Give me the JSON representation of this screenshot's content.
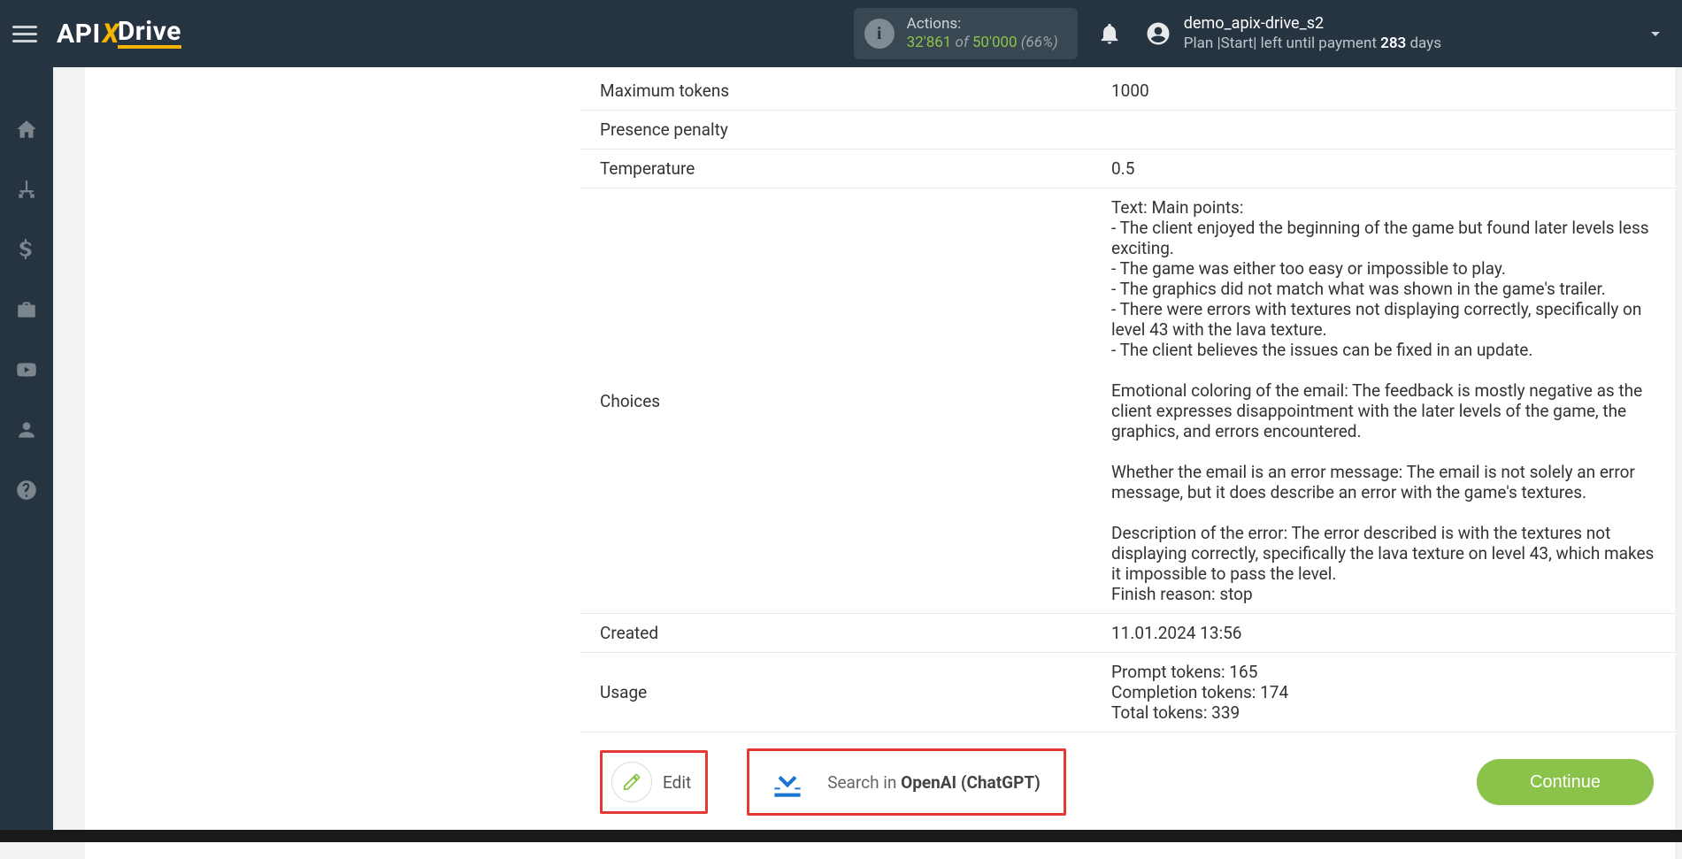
{
  "header": {
    "logo_part1": "API",
    "logo_x": "X",
    "logo_part2": "Drive",
    "actions_label": "Actions:",
    "actions_used": "32'861",
    "actions_of": " of ",
    "actions_total": "50'000",
    "actions_pct": " (66%)",
    "user_name": "demo_apix-drive_s2",
    "plan_a": "Plan |",
    "plan_name": "Start",
    "plan_b": "| left until payment ",
    "plan_days_n": "283",
    "plan_days_t": " days"
  },
  "sidebar": {
    "items": [
      {
        "name": "home"
      },
      {
        "name": "sitemap"
      },
      {
        "name": "dollar"
      },
      {
        "name": "briefcase"
      },
      {
        "name": "youtube"
      },
      {
        "name": "user"
      },
      {
        "name": "help"
      }
    ]
  },
  "rows": {
    "max_tokens_k": "Maximum tokens",
    "max_tokens_v": "1000",
    "presence_k": "Presence penalty",
    "presence_v": "",
    "temperature_k": "Temperature",
    "temperature_v": "0.5",
    "choices_k": "Choices",
    "choices_v": "Text: Main points:\n- The client enjoyed the beginning of the game but found later levels less exciting.\n- The game was either too easy or impossible to play.\n- The graphics did not match what was shown in the game's trailer.\n- There were errors with textures not displaying correctly, specifically on level 43 with the lava texture.\n- The client believes the issues can be fixed in an update.\n\nEmotional coloring of the email: The feedback is mostly negative as the client expresses disappointment with the later levels of the game, the graphics, and errors encountered.\n\nWhether the email is an error message: The email is not solely an error message, but it does describe an error with the game's textures.\n\nDescription of the error: The error described is with the textures not displaying correctly, specifically the lava texture on level 43, which makes it impossible to pass the level.\nFinish reason: stop",
    "created_k": "Created",
    "created_v": "11.01.2024 13:56",
    "usage_k": "Usage",
    "usage_v": "Prompt tokens: 165\nCompletion tokens: 174\nTotal tokens: 339"
  },
  "footer": {
    "edit": "Edit",
    "search_a": "Search in ",
    "search_b": "OpenAI (ChatGPT)",
    "continue": "Continue"
  }
}
